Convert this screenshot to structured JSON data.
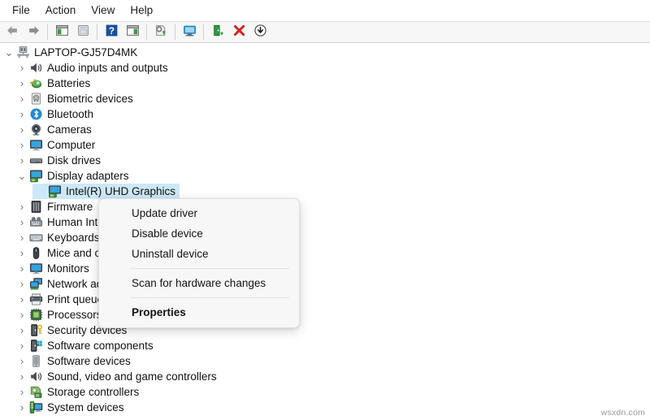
{
  "menubar": {
    "items": [
      {
        "label": "File",
        "name": "menu-file"
      },
      {
        "label": "Action",
        "name": "menu-action"
      },
      {
        "label": "View",
        "name": "menu-view"
      },
      {
        "label": "Help",
        "name": "menu-help"
      }
    ]
  },
  "toolbar": {
    "buttons": [
      {
        "icon": "back-arrow-icon",
        "title": "Back"
      },
      {
        "icon": "forward-arrow-icon",
        "title": "Forward"
      },
      {
        "sep": true
      },
      {
        "icon": "show-hide-console-tree-icon",
        "title": "Show/Hide Console Tree"
      },
      {
        "icon": "properties-window-icon",
        "title": "Properties"
      },
      {
        "sep": true
      },
      {
        "icon": "help-question-icon",
        "title": "Help"
      },
      {
        "icon": "show-hide-action-pane-icon",
        "title": "Show/Hide Action Pane"
      },
      {
        "sep": true
      },
      {
        "icon": "update-driver-icon",
        "title": "Update driver"
      },
      {
        "sep": true
      },
      {
        "icon": "scan-hardware-changes-icon",
        "title": "Scan for hardware changes"
      },
      {
        "sep": true
      },
      {
        "icon": "enable-device-icon",
        "title": "Enable device"
      },
      {
        "icon": "uninstall-device-icon",
        "title": "Uninstall device"
      },
      {
        "icon": "disable-device-icon",
        "title": "Disable device"
      }
    ]
  },
  "tree": {
    "rows": [
      {
        "label": "LAPTOP-GJ57D4MK",
        "level": 0,
        "state": "expanded",
        "icon": "computer-root-icon",
        "name": "tree-item-laptop-gj57d4mk"
      },
      {
        "label": "Audio inputs and outputs",
        "level": 1,
        "state": "collapsed",
        "icon": "speaker-icon",
        "name": "tree-item-audio-inputs-and-outputs"
      },
      {
        "label": "Batteries",
        "level": 1,
        "state": "collapsed",
        "icon": "battery-icon",
        "name": "tree-item-batteries"
      },
      {
        "label": "Biometric devices",
        "level": 1,
        "state": "collapsed",
        "icon": "fingerprint-icon",
        "name": "tree-item-biometric-devices"
      },
      {
        "label": "Bluetooth",
        "level": 1,
        "state": "collapsed",
        "icon": "bluetooth-icon",
        "name": "tree-item-bluetooth"
      },
      {
        "label": "Cameras",
        "level": 1,
        "state": "collapsed",
        "icon": "camera-icon",
        "name": "tree-item-cameras"
      },
      {
        "label": "Computer",
        "level": 1,
        "state": "collapsed",
        "icon": "monitor-icon",
        "name": "tree-item-computer"
      },
      {
        "label": "Disk drives",
        "level": 1,
        "state": "collapsed",
        "icon": "disk-drive-icon",
        "name": "tree-item-disk-drives"
      },
      {
        "label": "Display adapters",
        "level": 1,
        "state": "expanded",
        "icon": "display-adapter-icon",
        "name": "tree-item-display-adapters"
      },
      {
        "label": "Intel(R) UHD Graphics",
        "level": 2,
        "state": "none",
        "icon": "display-adapter-icon",
        "name": "tree-item-intel-uhd-graphics",
        "selected": true
      },
      {
        "label": "Firmware",
        "level": 1,
        "state": "collapsed",
        "icon": "firmware-icon",
        "name": "tree-item-firmware"
      },
      {
        "label": "Human Interface Devices",
        "level": 1,
        "state": "collapsed",
        "icon": "hid-icon",
        "name": "tree-item-human-interface-devices"
      },
      {
        "label": "Keyboards",
        "level": 1,
        "state": "collapsed",
        "icon": "keyboard-icon",
        "name": "tree-item-keyboards"
      },
      {
        "label": "Mice and other pointing devices",
        "level": 1,
        "state": "collapsed",
        "icon": "mouse-icon",
        "name": "tree-item-mice-and-other-pointing-devices"
      },
      {
        "label": "Monitors",
        "level": 1,
        "state": "collapsed",
        "icon": "monitor-icon",
        "name": "tree-item-monitors"
      },
      {
        "label": "Network adapters",
        "level": 1,
        "state": "collapsed",
        "icon": "network-adapter-icon",
        "name": "tree-item-network-adapters"
      },
      {
        "label": "Print queues",
        "level": 1,
        "state": "collapsed",
        "icon": "printer-icon",
        "name": "tree-item-print-queues"
      },
      {
        "label": "Processors",
        "level": 1,
        "state": "collapsed",
        "icon": "processor-icon",
        "name": "tree-item-processors"
      },
      {
        "label": "Security devices",
        "level": 1,
        "state": "collapsed",
        "icon": "security-device-icon",
        "name": "tree-item-security-devices"
      },
      {
        "label": "Software components",
        "level": 1,
        "state": "collapsed",
        "icon": "software-component-icon",
        "name": "tree-item-software-components"
      },
      {
        "label": "Software devices",
        "level": 1,
        "state": "collapsed",
        "icon": "software-device-icon",
        "name": "tree-item-software-devices"
      },
      {
        "label": "Sound, video and game controllers",
        "level": 1,
        "state": "collapsed",
        "icon": "speaker-icon",
        "name": "tree-item-sound-video-and-game-controllers"
      },
      {
        "label": "Storage controllers",
        "level": 1,
        "state": "collapsed",
        "icon": "storage-controller-icon",
        "name": "tree-item-storage-controllers"
      },
      {
        "label": "System devices",
        "level": 1,
        "state": "collapsed",
        "icon": "system-device-icon",
        "name": "tree-item-system-devices"
      }
    ],
    "expander_expanded_glyph": "⌄",
    "expander_collapsed_glyph": "›"
  },
  "context_menu": {
    "items": [
      {
        "label": "Update driver",
        "type": "item",
        "name": "context-menu-update-driver"
      },
      {
        "label": "Disable device",
        "type": "item",
        "name": "context-menu-disable-device"
      },
      {
        "label": "Uninstall device",
        "type": "item",
        "name": "context-menu-uninstall-device"
      },
      {
        "type": "separator"
      },
      {
        "label": "Scan for hardware changes",
        "type": "item",
        "name": "context-menu-scan-for-hardware-changes"
      },
      {
        "type": "separator"
      },
      {
        "label": "Properties",
        "type": "item",
        "bold": true,
        "name": "context-menu-properties"
      }
    ]
  },
  "watermark": {
    "text": "wsxdn.com"
  },
  "colors": {
    "selection": "#cde8f7",
    "toolbar_bg": "#f7f7f7",
    "menu_bg": "#f7f7f7",
    "separator": "#e3e3e3",
    "text": "#111111"
  }
}
